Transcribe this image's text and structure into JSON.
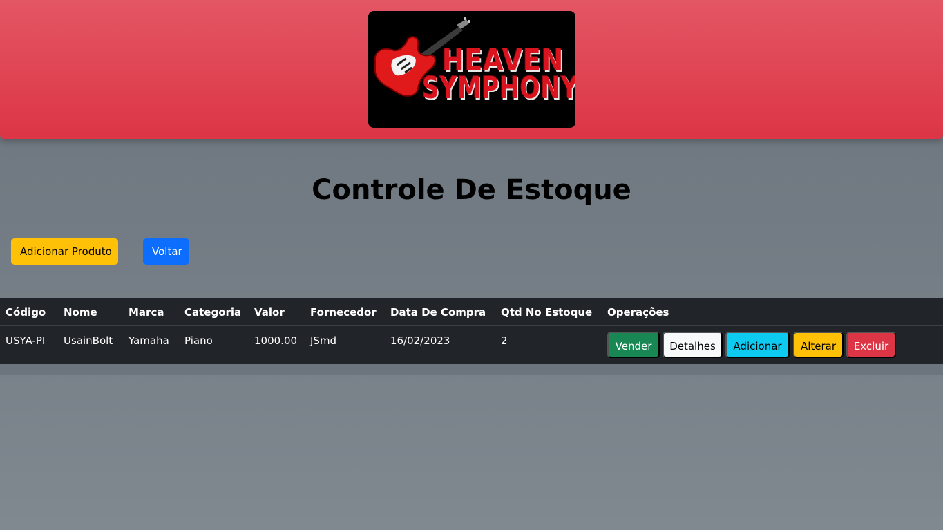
{
  "header": {
    "logo": {
      "line1": "HEAVEN",
      "line2": "SYMPHONY",
      "icon": "electric-guitar-icon"
    }
  },
  "main": {
    "title": "Controle De Estoque",
    "add_product_label": "Adicionar Produto",
    "back_label": "Voltar"
  },
  "table": {
    "columns": [
      "Código",
      "Nome",
      "Marca",
      "Categoria",
      "Valor",
      "Fornecedor",
      "Data De Compra",
      "Qtd No Estoque",
      "Operações"
    ],
    "rows": [
      {
        "codigo": "USYA-PI",
        "nome": "UsainBolt",
        "marca": "Yamaha",
        "categoria": "Piano",
        "valor": "1000.00",
        "fornecedor": "JSmd",
        "data_compra": "16/02/2023",
        "qtd": "2",
        "operations": {
          "vender": "Vender",
          "detalhes": "Detalhes",
          "adicionar": "Adicionar",
          "alterar": "Alterar",
          "excluir": "Excluir"
        }
      }
    ]
  },
  "colors": {
    "header": "#dc3545",
    "background": "#6c757d",
    "table": "#212529",
    "success": "#198754",
    "light": "#f8f9fa",
    "info": "#0dcaf0",
    "warning": "#ffc107",
    "danger": "#dc3545",
    "primary": "#0d6efd"
  }
}
